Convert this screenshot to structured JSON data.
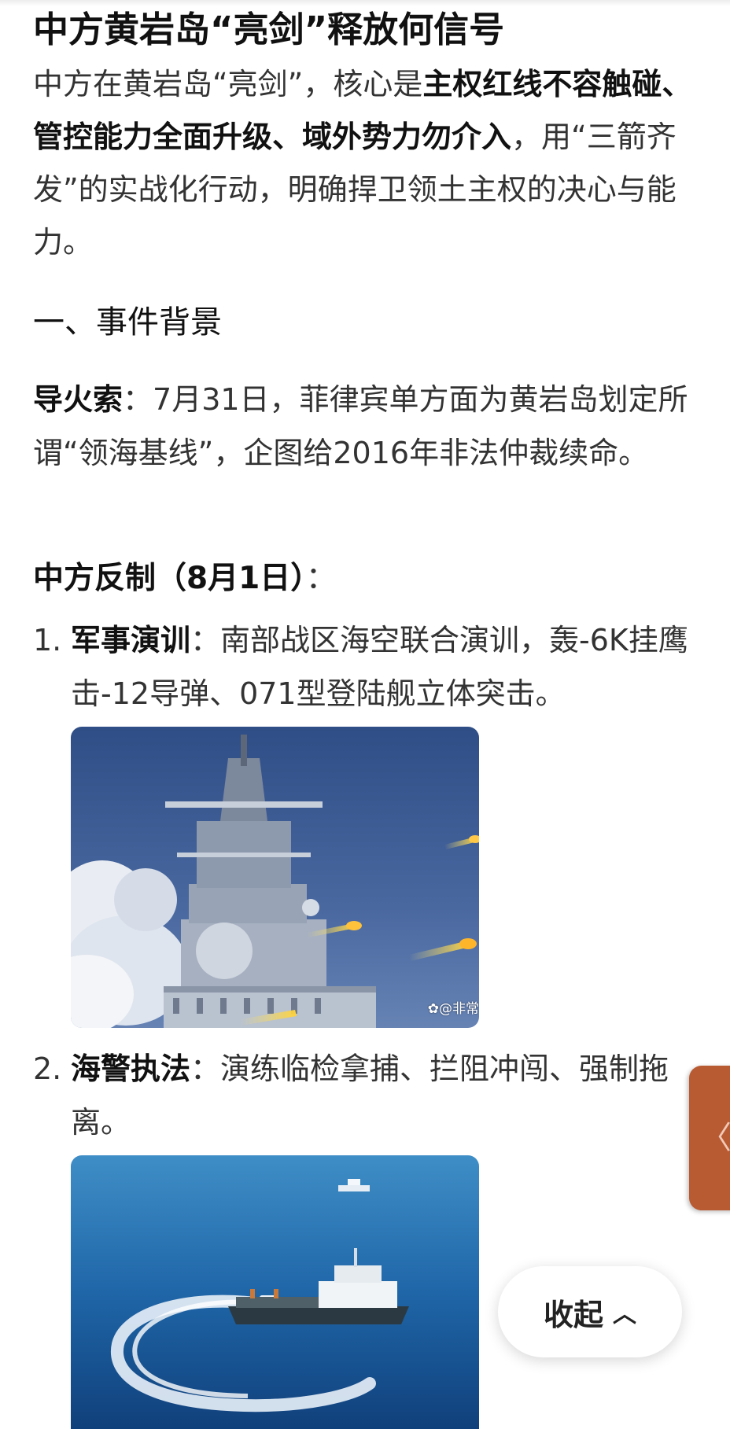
{
  "article": {
    "title": "中方黄岩岛“亮剑”释放何信号",
    "intro": {
      "prefix": "中方在黄岩岛“亮剑”，核心是",
      "bold": "主权红线不容触碰、管控能力全面升级、域外势力勿介入",
      "suffix": "，用“三箭齐发”的实战化行动，明确捍卫领土主权的决心与能力。"
    },
    "section1_heading": "一、事件背景",
    "trigger": {
      "label": "导火索",
      "text": "：7月31日，菲律宾单方面为黄岩岛划定所谓“领海基线”，企图给2016年非法仲裁续命。"
    },
    "countermeasures_heading": "中方反制（8月1日）",
    "countermeasures_colon": "：",
    "list": [
      {
        "num": "1.",
        "label": "军事演训",
        "text": "：南部战区海空联合演训，轰-6K挂鹰击-12导弹、071型登陆舰立体突击。"
      },
      {
        "num": "2.",
        "label": "海警执法",
        "text": "：演练临检拿捕、拦阻冲闯、强制拖离。"
      }
    ],
    "image1_watermark": "@非常",
    "image1_watermark_icon": "paw-icon",
    "image1_subject": "warship-missile-launch",
    "image2_subject": "coast-guard-ship-sea"
  },
  "ui": {
    "side_tab_icon": "chevron-left-icon",
    "side_tab_glyph": "〈",
    "collapse_label": "收起",
    "collapse_icon": "chevron-up-icon",
    "collapse_glyph": "^"
  },
  "colors": {
    "side_tab": "#b85a32",
    "text": "#333333",
    "heading": "#111111"
  }
}
